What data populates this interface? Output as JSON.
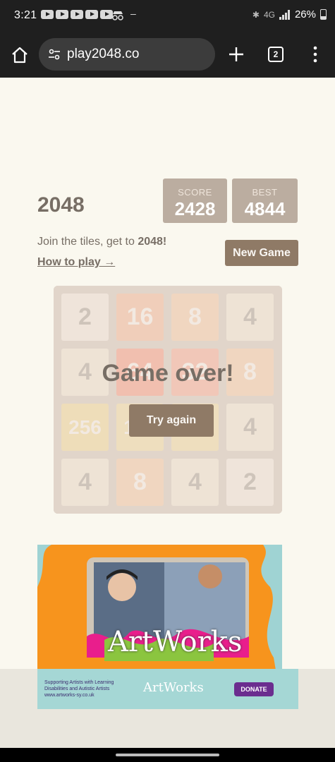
{
  "status_bar": {
    "time": "3:21",
    "network": "4G",
    "battery": "26%",
    "dash": "–"
  },
  "browser": {
    "url": "play2048.co",
    "tab_count": "2"
  },
  "game": {
    "title": "2048",
    "score_label": "SCORE",
    "score": "2428",
    "best_label": "BEST",
    "best": "4844",
    "intro_prefix": "Join the tiles, get to",
    "intro_bold": "2048!",
    "how_to_play": "How to play →",
    "new_game": "New Game",
    "game_over": "Game over!",
    "try_again": "Try again",
    "tiles": [
      [
        "2",
        "16",
        "8",
        "4"
      ],
      [
        "4",
        "64",
        "32",
        "8"
      ],
      [
        "256",
        "128",
        "128",
        "4"
      ],
      [
        "4",
        "8",
        "4",
        "2"
      ]
    ]
  },
  "ad": {
    "brand": "ArtWorks",
    "tagline": "Supporting Artists with Learning Disabilities and Autistic Artists",
    "website": "www.artworks-sy.co.uk",
    "donate": "DONATE"
  },
  "colors": {
    "tile_2": "#eee4da",
    "tile_4": "#ede0c8",
    "tile_8": "#f2b179",
    "tile_16": "#f59563",
    "tile_32": "#f67c5f",
    "tile_64": "#f65e3b",
    "tile_128": "#edcf72",
    "tile_256": "#edcc61"
  }
}
